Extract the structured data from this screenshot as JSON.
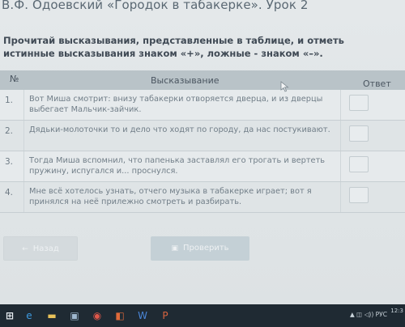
{
  "lesson_title": "В.Ф. Одоевский «Городок в табакерке». Урок 2",
  "instruction": "Прочитай высказывания, представленные в таблице, и отметь истинные высказывания знаком «+», ложные - знаком «–».",
  "table": {
    "col_num": "№",
    "col_statement": "Высказывание",
    "col_answer": "Ответ",
    "rows": [
      {
        "num": "1.",
        "text": "Вот Миша смотрит: внизу табакерки отворяется дверца, и из дверцы выбегает Мальчик-зайчик.",
        "answer": ""
      },
      {
        "num": "2.",
        "text": "Дядьки-молоточки то и дело что ходят по городу, да нас постукивают.",
        "answer": ""
      },
      {
        "num": "3.",
        "text": "Тогда Миша вспомнил, что папенька заставлял его трогать и вертеть пружину, испугался и... проснулся.",
        "answer": ""
      },
      {
        "num": "4.",
        "text": "Мне всё хотелось узнать, отчего музыка в табакерке играет; вот я принялся на неё прилежно смотреть и разбирать.",
        "answer": ""
      }
    ]
  },
  "buttons": {
    "back": "Назад",
    "check": "Проверить"
  },
  "taskbar": {
    "tray": "▲ ◫ ◁)) РУС",
    "clock": "12:3"
  }
}
